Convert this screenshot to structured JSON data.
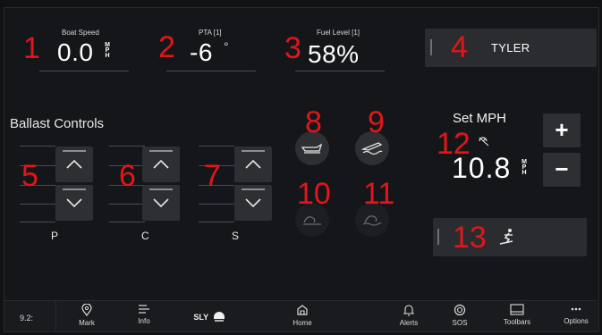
{
  "gauges": {
    "boat_speed": {
      "label": "Boat Speed",
      "value": "0.0",
      "unit": [
        "M",
        "P",
        "H"
      ]
    },
    "pta": {
      "label": "PTA [1]",
      "value": "-6",
      "unit": "°"
    },
    "fuel": {
      "label": "Fuel Level [1]",
      "value": "58%"
    }
  },
  "profile": {
    "name": "TYLER"
  },
  "ballast": {
    "title": "Ballast Controls",
    "columns": [
      "P",
      "C",
      "S"
    ]
  },
  "set_mph": {
    "title": "Set MPH",
    "value": "10.8",
    "unit": [
      "M",
      "P",
      "H"
    ],
    "plus": "+",
    "minus": "−"
  },
  "callouts": [
    "1",
    "2",
    "3",
    "4",
    "5",
    "6",
    "7",
    "8",
    "9",
    "10",
    "11",
    "12",
    "13"
  ],
  "bottom_bar": {
    "clock": "9.2:",
    "brand": "SLY",
    "items": [
      {
        "label": "Mark",
        "icon": "location-pin-icon"
      },
      {
        "label": "Info",
        "icon": "info-lines-icon"
      },
      {
        "label": "Home",
        "icon": "home-icon"
      },
      {
        "label": "Alerts",
        "icon": "bell-icon"
      },
      {
        "label": "SOS",
        "icon": "lifebuoy-icon"
      },
      {
        "label": "Toolbars",
        "icon": "toolbar-icon"
      },
      {
        "label": "Options",
        "icon": "more-dots-icon"
      }
    ]
  },
  "colors": {
    "background": "#111214",
    "panel": "#2d2f33",
    "callout": "#e0161a",
    "text": "#ffffff"
  }
}
